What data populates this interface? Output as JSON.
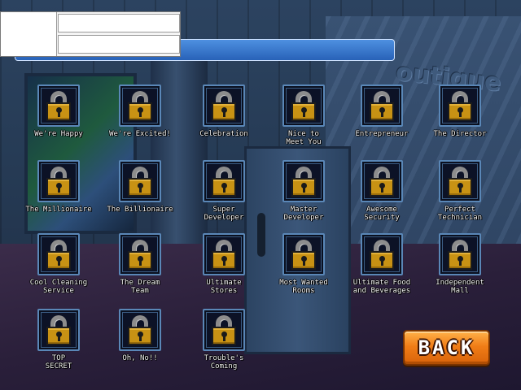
{
  "scene": {
    "sign_text": "outique"
  },
  "devpanel": {
    "title_text": ""
  },
  "achievements": [
    {
      "label": "We're Happy",
      "locked": true
    },
    {
      "label": "We're Excited!",
      "locked": true
    },
    {
      "label": "Celebration",
      "locked": true
    },
    {
      "label": "Nice to\nMeet You",
      "locked": true
    },
    {
      "label": "Entrepreneur",
      "locked": true
    },
    {
      "label": "The Director",
      "locked": true
    },
    {
      "label": "The Millionaire",
      "locked": true
    },
    {
      "label": "The Billionaire",
      "locked": true
    },
    {
      "label": "Super\nDeveloper",
      "locked": true
    },
    {
      "label": "Master\nDeveloper",
      "locked": true
    },
    {
      "label": "Awesome\nSecurity",
      "locked": true
    },
    {
      "label": "Perfect\nTechnician",
      "locked": true
    },
    {
      "label": "Cool Cleaning\nService",
      "locked": true
    },
    {
      "label": "The Dream\nTeam",
      "locked": true
    },
    {
      "label": "Ultimate\nStores",
      "locked": true
    },
    {
      "label": "Most Wanted\nRooms",
      "locked": true
    },
    {
      "label": "Ultimate Food\nand Beverages",
      "locked": true
    },
    {
      "label": "Independent\nMall",
      "locked": true
    },
    {
      "label": "TOP\nSECRET",
      "locked": true
    },
    {
      "label": "Oh, No!!",
      "locked": true
    },
    {
      "label": "Trouble's\nComing",
      "locked": true
    }
  ],
  "back_button": {
    "label": "BACK"
  },
  "colors": {
    "badge_border": "#5a87b7",
    "lock_gold": "#c89214",
    "back_orange": "#f07d17",
    "titlebar_blue": "#2862b8"
  },
  "icons": {
    "achievement": "padlock-icon"
  }
}
